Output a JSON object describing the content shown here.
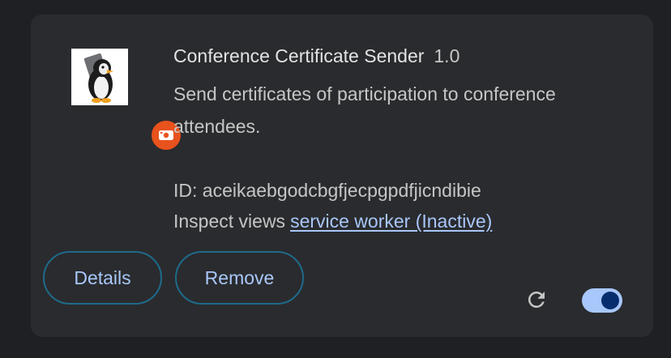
{
  "extension": {
    "name": "Conference Certificate Sender",
    "version": "1.0",
    "description": "Send certificates of participation to conference attendees.",
    "id_line": "ID: aceikaebgodcbgfjecpgpdfjicndibie",
    "inspect_label": "Inspect views",
    "inspect_link": "service worker (Inactive)",
    "icon": "penguin-icon",
    "badge_icon": "unpacked-extension-badge-icon",
    "enabled": true
  },
  "actions": {
    "details_label": "Details",
    "remove_label": "Remove",
    "reload_icon": "reload-icon"
  },
  "colors": {
    "background": "#1f2023",
    "card": "#2a2b2e",
    "accent": "#a8c7fa",
    "badge": "#e8521d",
    "button_border": "#1e6a8a",
    "toggle_knob": "#062e6f"
  }
}
